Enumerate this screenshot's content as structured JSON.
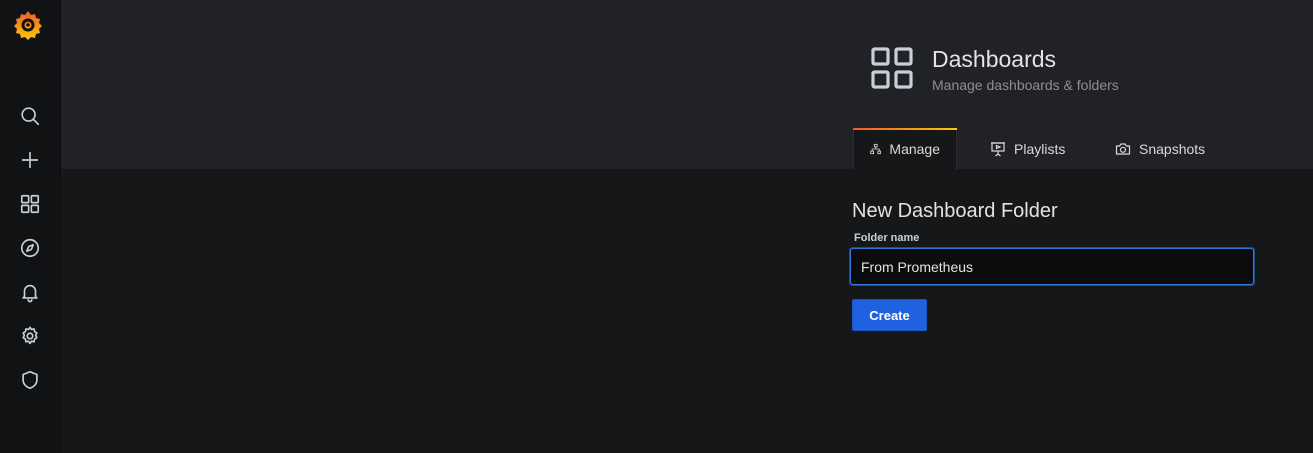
{
  "sidebar": {
    "logo": "grafana-logo",
    "items": [
      {
        "icon": "search-icon"
      },
      {
        "icon": "plus-icon"
      },
      {
        "icon": "dashboards-icon"
      },
      {
        "icon": "compass-icon"
      },
      {
        "icon": "bell-icon"
      },
      {
        "icon": "gear-icon"
      },
      {
        "icon": "shield-icon"
      }
    ]
  },
  "header": {
    "title": "Dashboards",
    "subtitle": "Manage dashboards & folders",
    "tabs": [
      {
        "label": "Manage",
        "icon": "sitemap-icon",
        "active": true
      },
      {
        "label": "Playlists",
        "icon": "presentation-icon",
        "active": false
      },
      {
        "label": "Snapshots",
        "icon": "camera-icon",
        "active": false
      }
    ]
  },
  "form": {
    "title": "New Dashboard Folder",
    "folder_label": "Folder name",
    "folder_value": "From Prometheus",
    "create_label": "Create"
  },
  "colors": {
    "accent_blue": "#1f62e0",
    "tab_gradient_start": "#f05a28",
    "tab_gradient_end": "#fbca0a"
  }
}
